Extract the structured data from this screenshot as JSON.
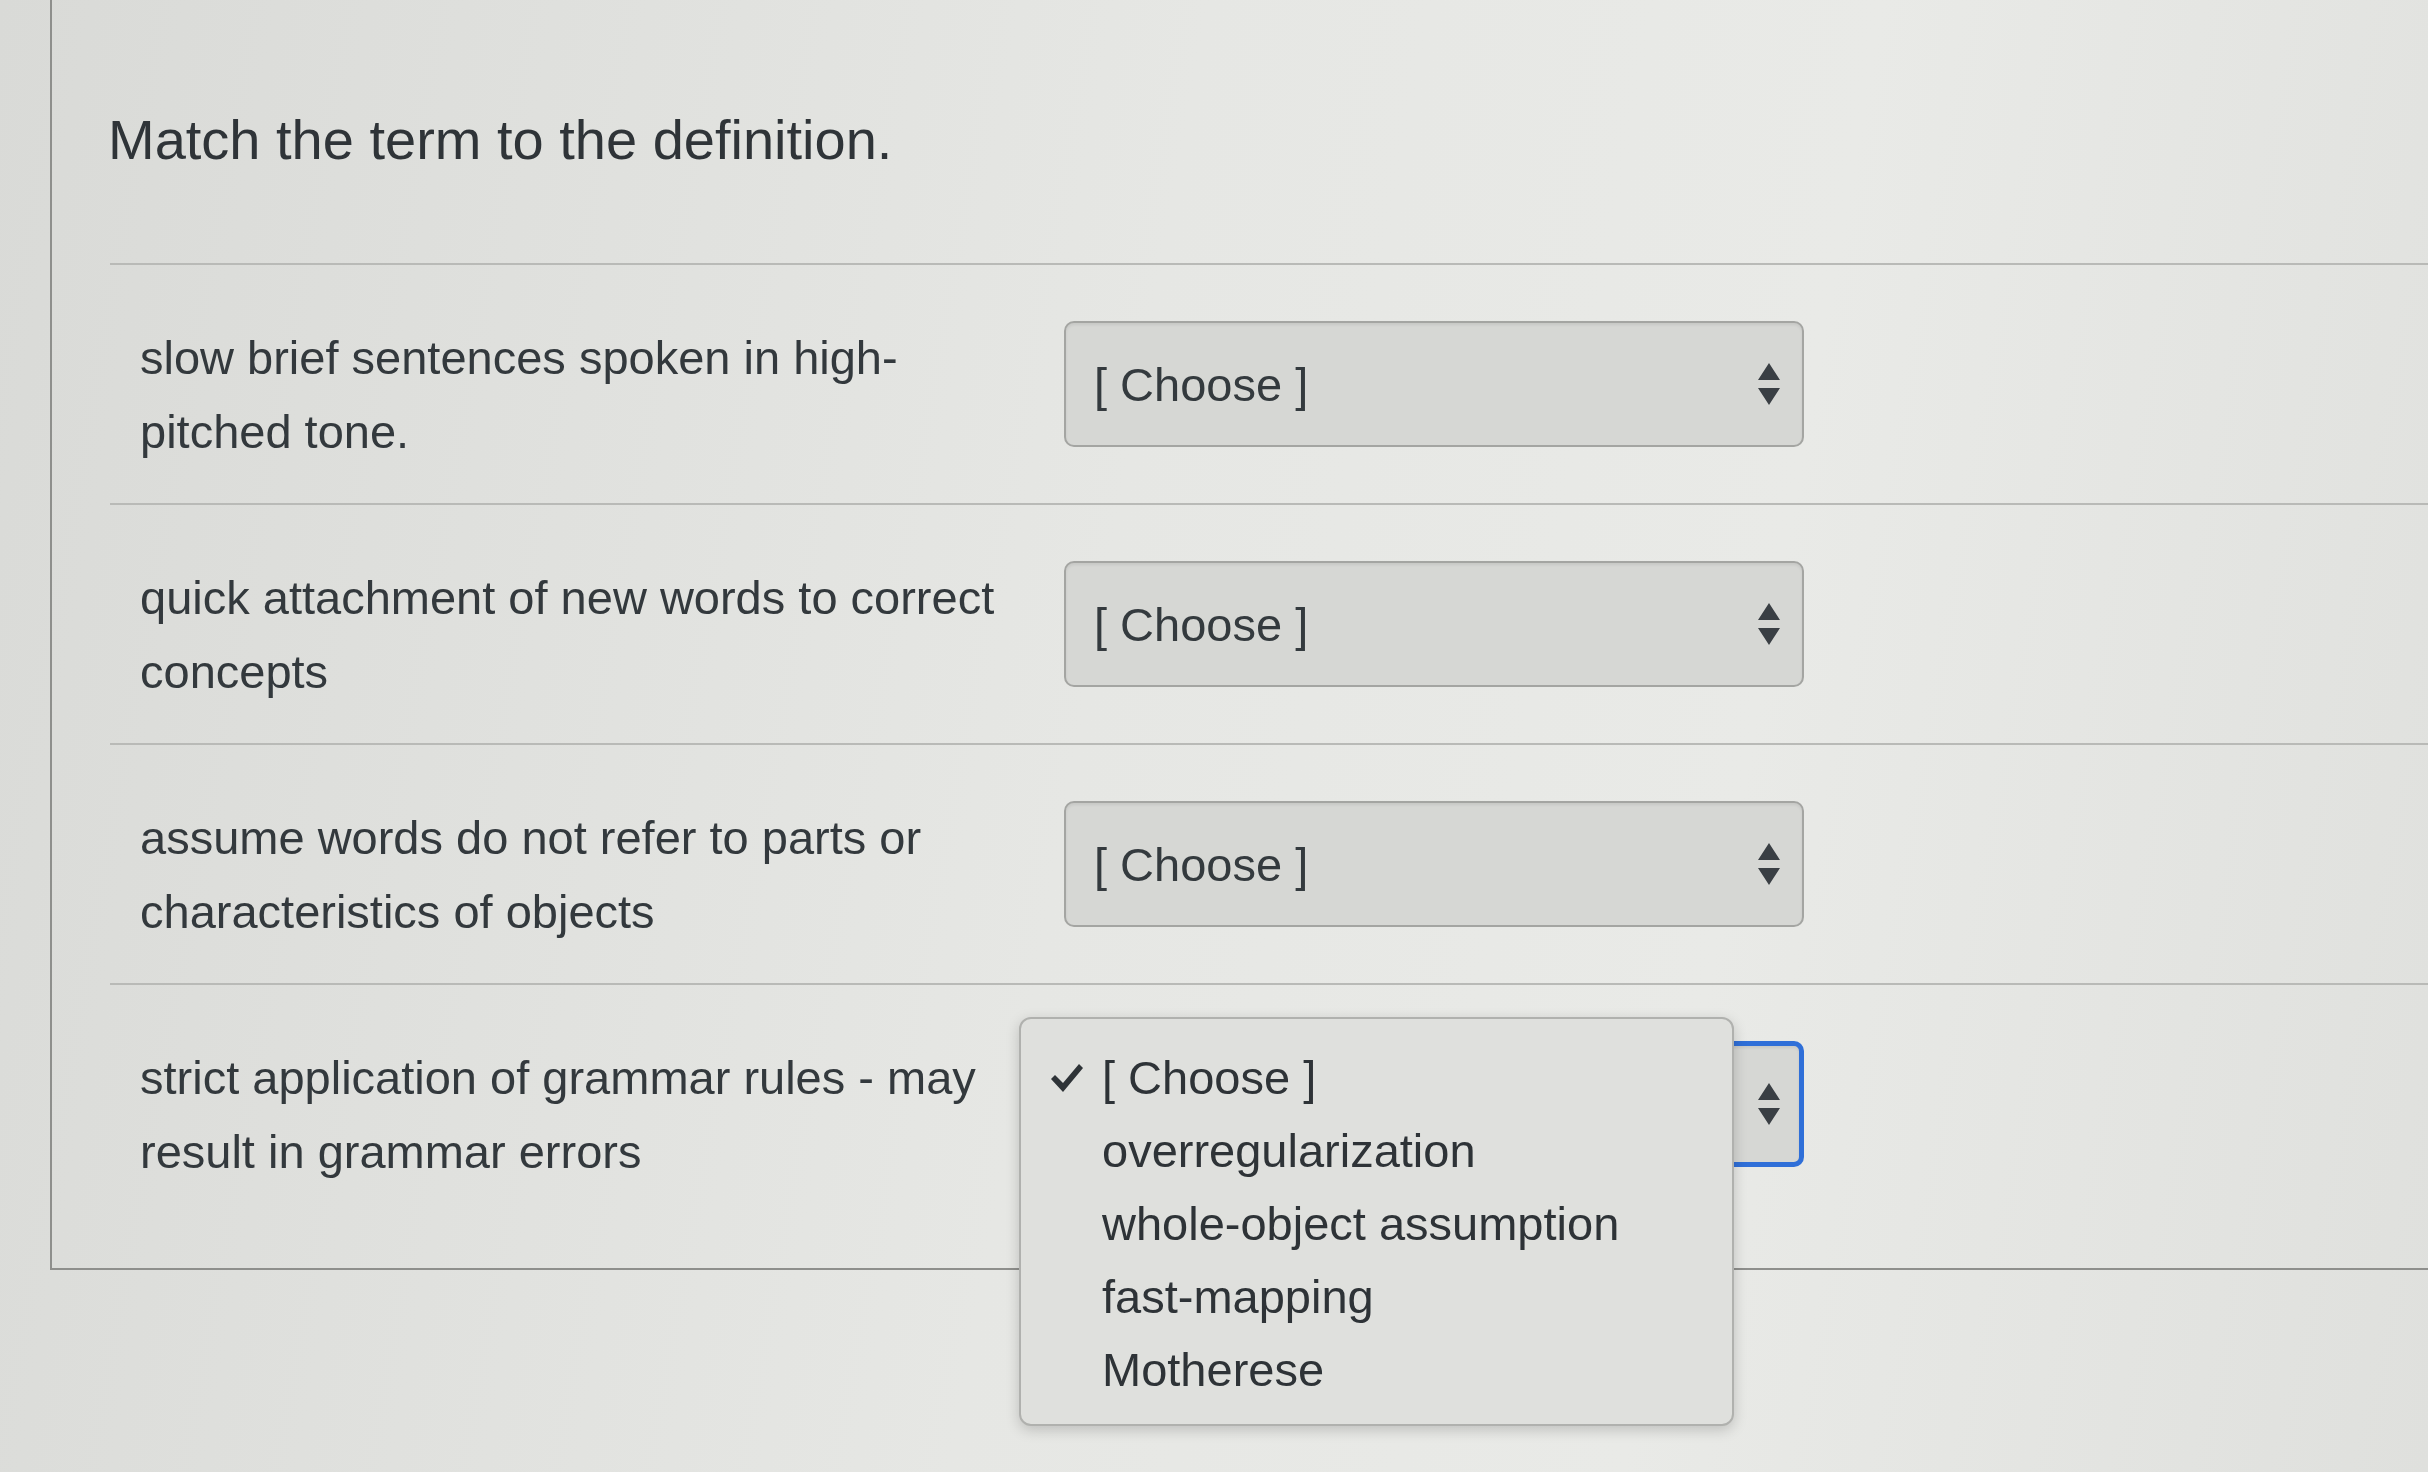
{
  "question": {
    "title": "Match the term to the definition."
  },
  "matches": [
    {
      "definition": "slow brief sentences spoken in high-pitched tone.",
      "value": "[ Choose ]",
      "expanded": false
    },
    {
      "definition": "quick attachment of new words to correct concepts",
      "value": "[ Choose ]",
      "expanded": false
    },
    {
      "definition": "assume words do not refer to parts or characteristics of objects",
      "value": "[ Choose ]",
      "expanded": false
    },
    {
      "definition": "strict application of grammar rules - may result in grammar errors",
      "expanded": true,
      "options": [
        {
          "label": "[ Choose ]",
          "selected": true
        },
        {
          "label": "overregularization",
          "selected": false
        },
        {
          "label": "whole-object assumption",
          "selected": false
        },
        {
          "label": "fast-mapping",
          "selected": false
        },
        {
          "label": "Motherese",
          "selected": false
        }
      ]
    }
  ]
}
